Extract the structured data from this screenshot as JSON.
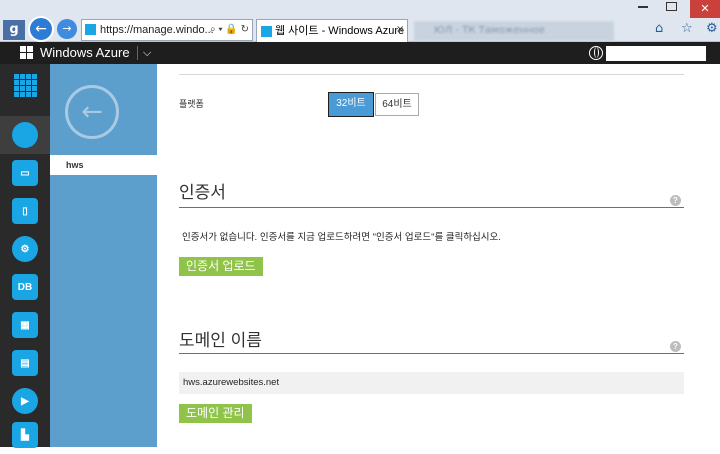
{
  "browser": {
    "address_text": "https://manage.windo...",
    "address_tools": "⌕ ▾ 🔒 ↻",
    "tab_title": "웹 사이트 - Windows Azure",
    "tab_close": "×",
    "other_tab_text": "ЮЛ - ТК Таможенное",
    "search_glyph": "g",
    "close_glyph": "✕"
  },
  "azure_header": {
    "title": "Windows Azure",
    "chevron": "⌵"
  },
  "left_nav": {
    "items": [
      {
        "name": "all-items",
        "glyph": ""
      },
      {
        "name": "web-sites",
        "glyph": ""
      },
      {
        "name": "virtual-machines",
        "glyph": "▭"
      },
      {
        "name": "mobile-services",
        "glyph": "▯"
      },
      {
        "name": "cloud-services",
        "glyph": "⚙"
      },
      {
        "name": "sql-databases",
        "glyph": "DB"
      },
      {
        "name": "storage",
        "glyph": "▦"
      },
      {
        "name": "hdinsight",
        "glyph": "▤"
      },
      {
        "name": "media-services",
        "glyph": "▶"
      },
      {
        "name": "service-bus",
        "glyph": "▙"
      }
    ]
  },
  "panel2": {
    "back_glyph": "←",
    "selected_item": "hws"
  },
  "main": {
    "platform_label": "플랫폼",
    "platform_32": "32비트",
    "platform_64": "64비트",
    "cert_title": "인증서",
    "cert_message": "인증서가 없습니다. 인증서를 지금 업로드하려면 \"인증서 업로드\"를 클릭하십시오.",
    "cert_upload_button": "인증서 업로드",
    "domain_title": "도메인 이름",
    "domain_value": "hws.azurewebsites.net",
    "domain_manage_button": "도메인 관리",
    "help_glyph": "?"
  },
  "colors": {
    "accent": "#1aa6e4",
    "panel": "#5d9fcc",
    "green": "#8fc34a",
    "nav_bg": "#2a2a2a"
  }
}
